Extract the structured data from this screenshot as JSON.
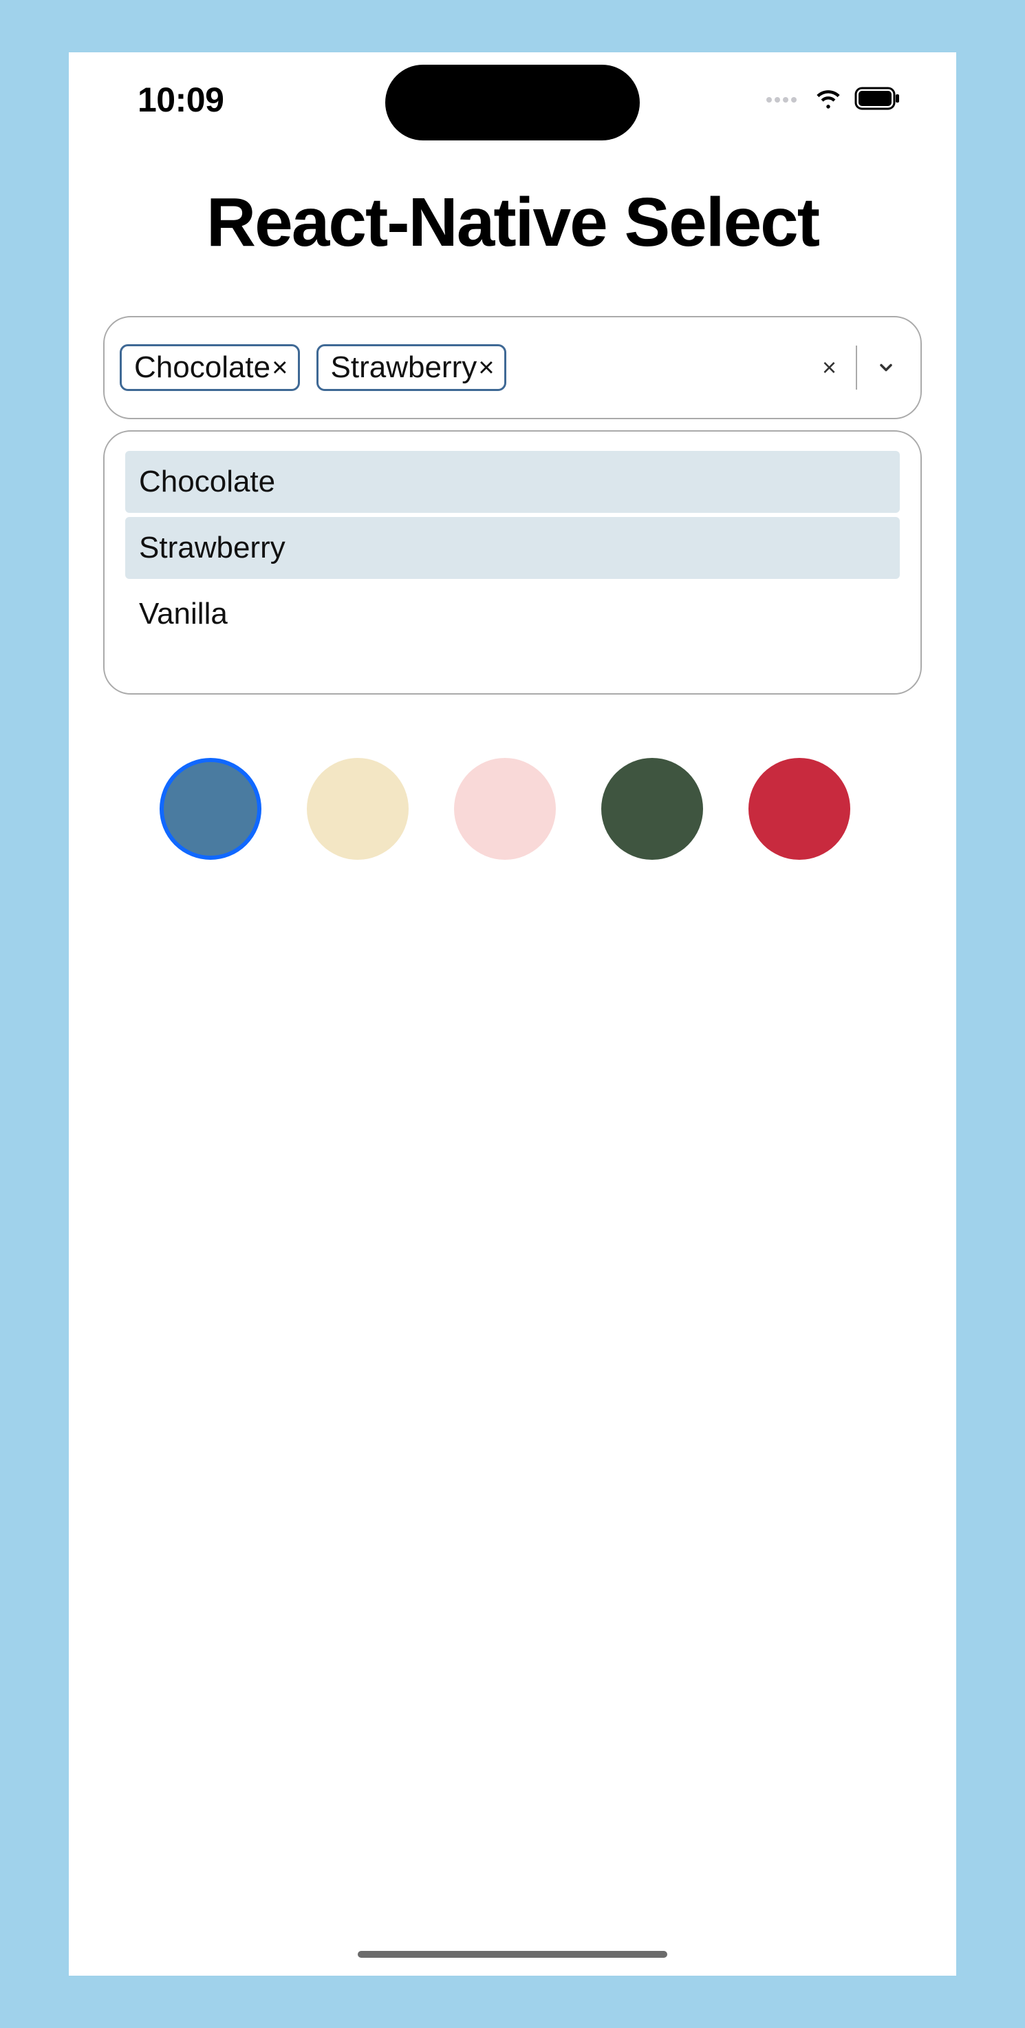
{
  "status": {
    "time": "10:09"
  },
  "page": {
    "title": "React-Native Select"
  },
  "select": {
    "chips": [
      {
        "label": "Chocolate"
      },
      {
        "label": "Strawberry"
      }
    ],
    "options": [
      {
        "label": "Chocolate",
        "selected": true
      },
      {
        "label": "Strawberry",
        "selected": true
      },
      {
        "label": "Vanilla",
        "selected": false
      }
    ],
    "chip_remove_glyph": "×",
    "clear_glyph": "×"
  },
  "swatches": [
    {
      "color": "#4a7ba0",
      "active": true
    },
    {
      "color": "#f3e6c4",
      "active": false
    },
    {
      "color": "#f9d9d8",
      "active": false
    },
    {
      "color": "#3f5540",
      "active": false
    },
    {
      "color": "#c82a3e",
      "active": false
    }
  ]
}
